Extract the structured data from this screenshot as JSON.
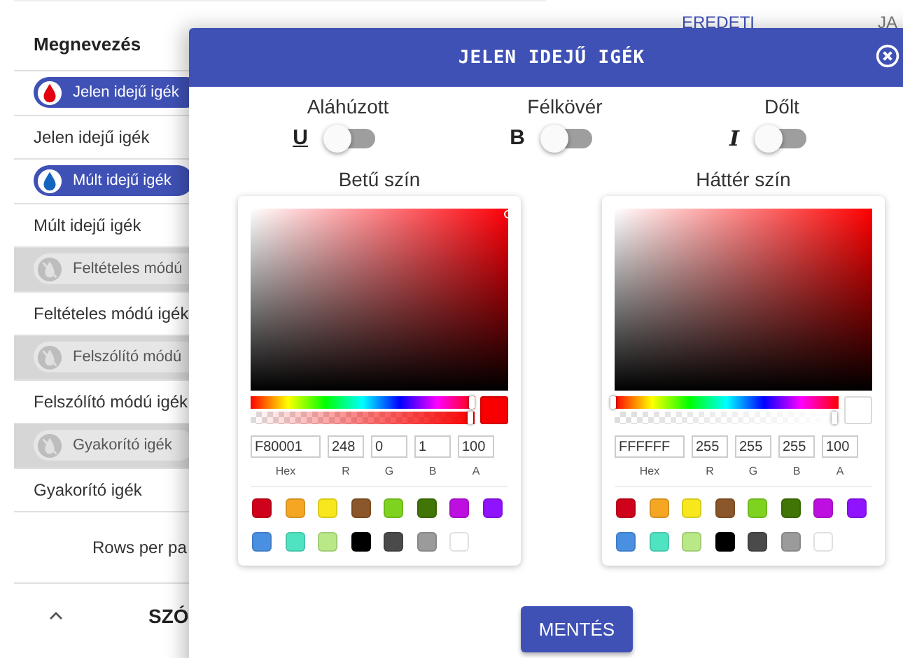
{
  "table": {
    "header": "Megnevezés",
    "rows": [
      {
        "chip": {
          "label": "Jelen idejű igék",
          "enabled": true,
          "color": "#e3000f"
        },
        "text": "Jelen idejű igék"
      },
      {
        "chip": {
          "label": "Múlt idejű igék",
          "enabled": true,
          "color": "#1565c0"
        },
        "text": "Múlt idejű igék"
      },
      {
        "chip": {
          "label": "Feltételes módú",
          "enabled": false
        },
        "text": "Feltételes módú igék"
      },
      {
        "chip": {
          "label": "Felszólító módú",
          "enabled": false
        },
        "text": "Felszólító módú igék"
      },
      {
        "chip": {
          "label": "Gyakorító igék",
          "enabled": false
        },
        "text": "Gyakorító igék"
      }
    ],
    "rows_per_page": "Rows per pa",
    "section": "SZÓ"
  },
  "background_columns": [
    "EREDETI",
    "JA"
  ],
  "dialog": {
    "title": "JELEN IDEJŰ IGÉK",
    "toggles": [
      {
        "label": "Aláhúzott",
        "kind": "underline",
        "glyph": "U",
        "on": false
      },
      {
        "label": "Félkövér",
        "kind": "bold",
        "glyph": "B",
        "on": false
      },
      {
        "label": "Dőlt",
        "kind": "italic",
        "glyph": "I",
        "on": false
      }
    ],
    "pickers": [
      {
        "label": "Betű szín",
        "hex": "F80001",
        "r": "248",
        "g": "0",
        "b": "1",
        "a": "100",
        "hue": {
          "level": 0.995
        },
        "alpha": {
          "level": 0.99
        },
        "field_labels": [
          "Hex",
          "R",
          "G",
          "B",
          "A"
        ],
        "swatches": [
          {
            "color": "#d0021b"
          },
          {
            "color": "#f5a623"
          },
          {
            "color": "#f8e71c"
          },
          {
            "color": "#8b572a"
          },
          {
            "color": "#7ed321"
          },
          {
            "color": "#417505"
          },
          {
            "color": "#bd10e0"
          },
          {
            "color": "#9013fe"
          },
          {
            "color": "#4a90e2"
          },
          {
            "color": "#50e3c2"
          },
          {
            "color": "#b8e986"
          },
          {
            "color": "#000000"
          },
          {
            "color": "#4a4a4a"
          },
          {
            "color": "#9b9b9b"
          },
          {
            "color": "#ffffff"
          }
        ]
      },
      {
        "label": "Háttér szín",
        "hex": "FFFFFF",
        "r": "255",
        "g": "255",
        "b": "255",
        "a": "100",
        "hue": {
          "level": 0.0
        },
        "alpha": {
          "level": 0.99
        },
        "field_labels": [
          "Hex",
          "R",
          "G",
          "B",
          "A"
        ],
        "swatches": [
          {
            "color": "#d0021b"
          },
          {
            "color": "#f5a623"
          },
          {
            "color": "#f8e71c"
          },
          {
            "color": "#8b572a"
          },
          {
            "color": "#7ed321"
          },
          {
            "color": "#417505"
          },
          {
            "color": "#bd10e0"
          },
          {
            "color": "#9013fe"
          },
          {
            "color": "#4a90e2"
          },
          {
            "color": "#50e3c2"
          },
          {
            "color": "#b8e986"
          },
          {
            "color": "#000000"
          },
          {
            "color": "#4a4a4a"
          },
          {
            "color": "#9b9b9b"
          },
          {
            "color": "#ffffff"
          }
        ]
      }
    ],
    "save_button": "MENTÉS"
  }
}
